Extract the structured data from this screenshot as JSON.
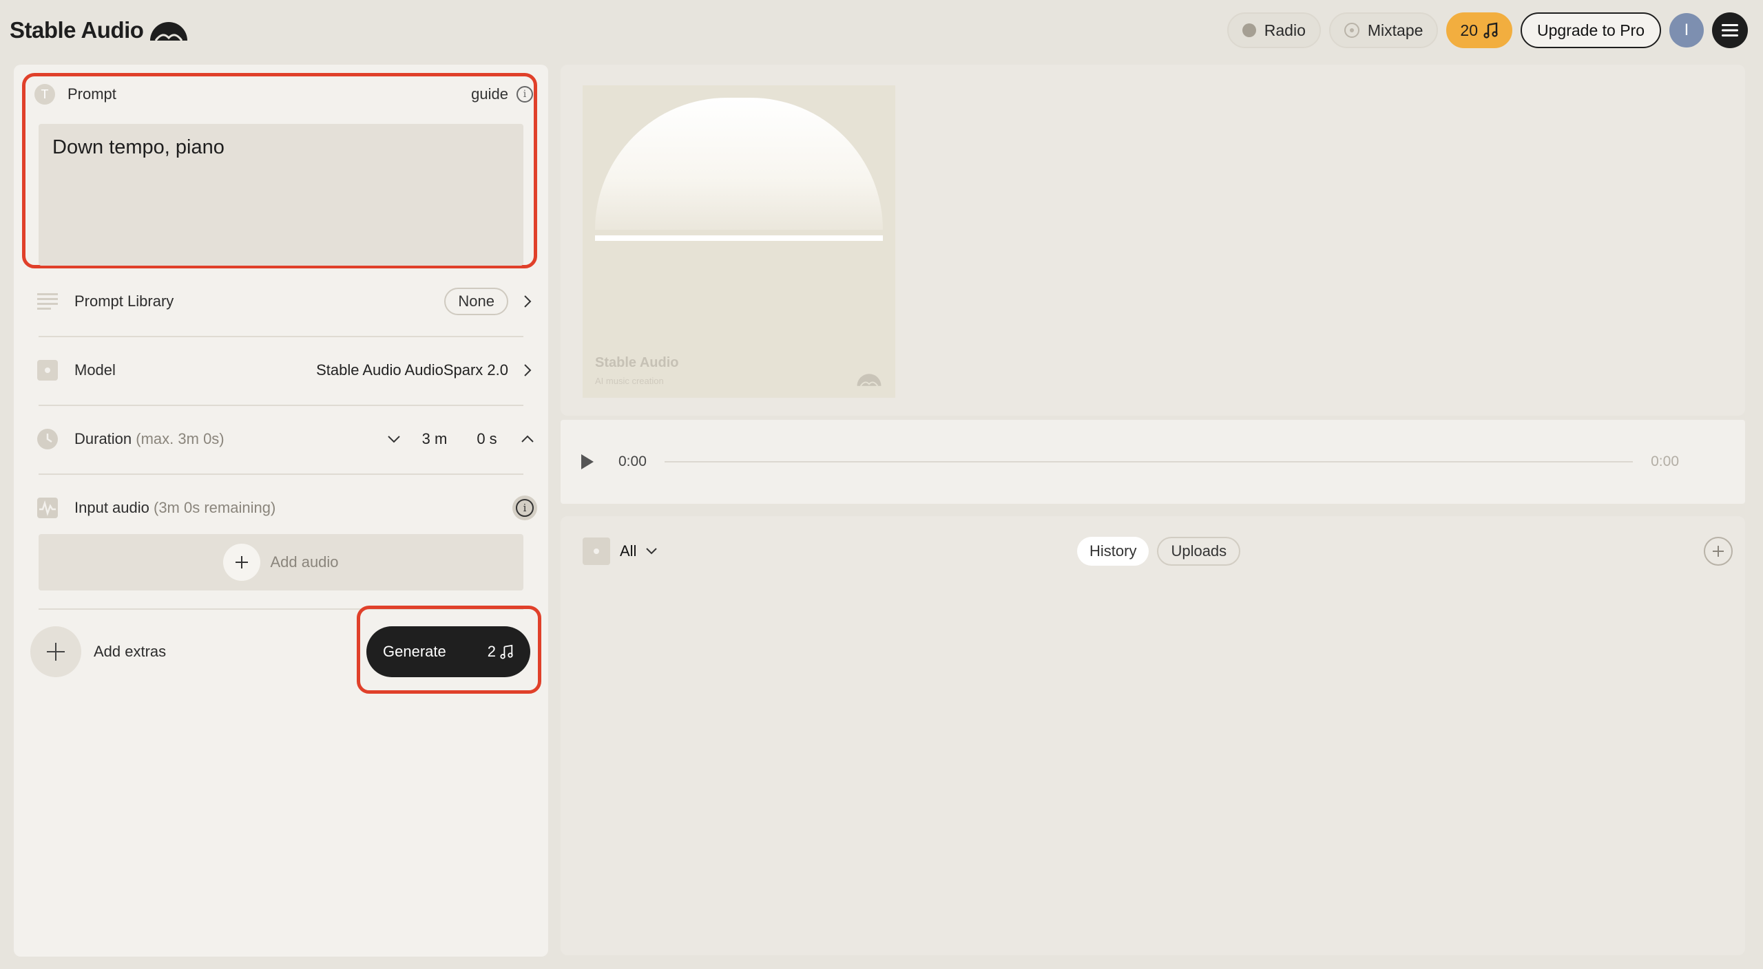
{
  "app": {
    "name": "Stable Audio"
  },
  "header": {
    "radio_label": "Radio",
    "mixtape_label": "Mixtape",
    "credits": "20",
    "upgrade_label": "Upgrade to Pro",
    "avatar_initial": "I"
  },
  "prompt": {
    "label": "Prompt",
    "icon_letter": "T",
    "guide_label": "guide",
    "value": "Down tempo, piano"
  },
  "settings": {
    "library_label": "Prompt Library",
    "library_value": "None",
    "model_label": "Model",
    "model_value": "Stable Audio AudioSparx 2.0",
    "duration_label": "Duration",
    "duration_hint": "(max. 3m 0s)",
    "duration_minutes": "3 m",
    "duration_seconds": "0 s",
    "input_audio_label": "Input audio",
    "input_audio_hint": "(3m 0s remaining)",
    "add_audio_label": "Add audio",
    "add_extras_label": "Add extras"
  },
  "generate": {
    "label": "Generate",
    "cost": "2"
  },
  "cover": {
    "title": "Stable Audio",
    "subtitle": "AI music creation"
  },
  "player": {
    "current_time": "0:00",
    "total_time": "0:00"
  },
  "library": {
    "filter_label": "All",
    "tabs": [
      {
        "label": "History",
        "active": true
      },
      {
        "label": "Uploads",
        "active": false
      }
    ]
  },
  "colors": {
    "background": "#e7e4dd",
    "highlight": "#e0402a",
    "credits": "#f2ae3f",
    "generate": "#1f1f1f"
  },
  "icons": [
    "logo-mark-icon",
    "radio-dot-icon",
    "mixtape-icon",
    "music-note-icon",
    "menu-icon",
    "info-icon",
    "list-icon",
    "model-icon",
    "clock-icon",
    "waveform-icon",
    "plus-icon",
    "play-icon",
    "chevron-right-icon",
    "chevron-down-icon",
    "chevron-up-icon"
  ]
}
